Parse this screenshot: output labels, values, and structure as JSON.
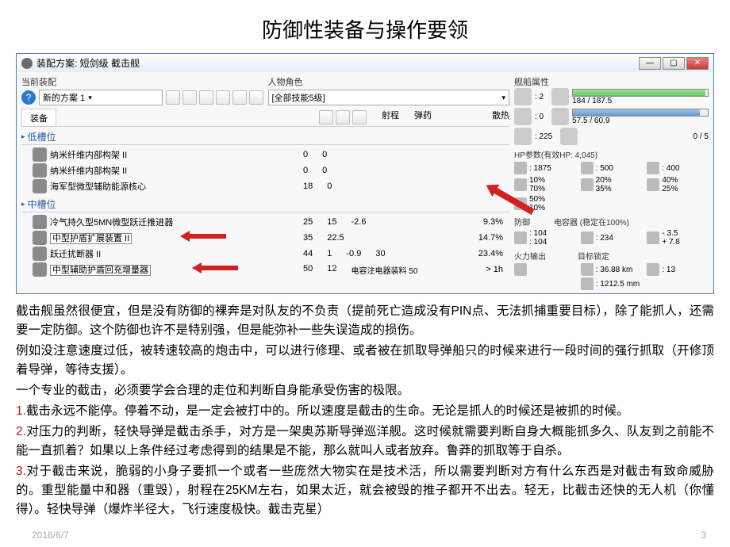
{
  "slide_title": "防御性装备与操作要领",
  "window": {
    "title": "装配方案: 短剑级 截击舰",
    "labels": {
      "current_fit": "当前装配",
      "char": "人物角色",
      "ship_attr": "舰船属性"
    },
    "scheme": "新的方案 1",
    "skill": "[全部技能5级]",
    "help": "?"
  },
  "tabs": {
    "equip": "装备"
  },
  "cols": {
    "c1": "射程",
    "c2": "弹药",
    "c3": "散热"
  },
  "sections": {
    "low": "低槽位",
    "mid": "中槽位"
  },
  "low_mods": [
    {
      "name": "纳米纤维内部构架 II",
      "v1": "0",
      "v2": "0"
    },
    {
      "name": "纳米纤维内部构架 II",
      "v1": "0",
      "v2": "0"
    },
    {
      "name": "海军型微型辅助能源核心",
      "v1": "18",
      "v2": "0"
    }
  ],
  "mid_mods": [
    {
      "name": "冷气持久型5MN微型跃迁推进器",
      "v1": "25",
      "v2": "15",
      "v3": "-2.6",
      "right": "9.3%"
    },
    {
      "name": "中型护盾扩展装置 II",
      "boxed": true,
      "v1": "35",
      "v2": "22.5",
      "right": "14.7%"
    },
    {
      "name": "跃迁扰断器 II",
      "v1": "44",
      "v2": "1",
      "v3": "-0.9",
      "v4": "30",
      "right": "23.4%"
    },
    {
      "name": "中型辅助护盾回充增量器",
      "boxed": true,
      "v1": "50",
      "v2": "12",
      "note": "电容注电器装料 50",
      "right": "> 1h"
    }
  ],
  "stats": {
    "hp_label": "184 / 187.5",
    "cap_label": "57.5 / 60.9",
    "slots": "0 / 5",
    "hp_header": "HP参数(有效HP: 4,045)",
    "shield": ": 1875",
    "armor": ": 500",
    "hull": ": 400",
    "res": [
      [
        "10%",
        "70%"
      ],
      [
        "20%",
        "35%"
      ],
      [
        "40%",
        "25%"
      ],
      [
        "50%",
        "10%"
      ]
    ],
    "defense_label": "防御",
    "def_v1": ": 104",
    "def_v2": ": 104",
    "cap_header": "电容器 (稳定在100%)",
    "cap_v": ": 234",
    "cap_delta1": "- 3.5",
    "cap_delta2": "+ 7.8",
    "dps_header": "火力输出",
    "lock_header": "目标锁定",
    "range": ": 36.88 km",
    "sig": ": 1212.5 mm",
    "targets": ": 13",
    "n2": ": 2",
    "n225": ": 225"
  },
  "body": {
    "p1": "截击舰虽然很便宜，但是没有防御的裸奔是对队友的不负责（提前死亡造成没有PIN点、无法抓捕重要目标），除了能抓人，还需要一定防御。这个防御也许不是特别强，但是能弥补一些失误造成的损伤。",
    "p2": "例如没注意速度过低，被转速较高的炮击中，可以进行修理、或者被在抓取导弹船只的时候来进行一段时间的强行抓取（开修顶着导弹，等待支援）。",
    "p3": " 一个专业的截击，必须要学会合理的走位和判断自身能承受伤害的极限。",
    "n1": "1.",
    "t1": "截击永远不能停。停着不动，是一定会被打中的。所以速度是截击的生命。无论是抓人的时候还是被抓的时候。",
    "n2": "2.",
    "t2": "对压力的判断，轻快导弹是截击杀手，对方是一架奥苏斯导弹巡洋舰。这时候就需要判断自身大概能抓多久、队友到之前能不能一直抓着？如果以上条件经过考虑得到的结果是不能，那么就叫人或者放弃。鲁莽的抓取等于自杀。",
    "n3": "3.",
    "t3": "对于截击来说，脆弱的小身子要抓一个或者一些庞然大物实在是技术活，所以需要判断对方有什么东西是对截击有致命威胁的。重型能量中和器（重毁），射程在25KM左右，如果太近，就会被毁的推子都开不出去。轻无，比截击还快的无人机（你懂得）。轻快导弹（爆炸半径大，飞行速度极快。截击克星）"
  },
  "page_num": "3",
  "date": "2016/6/7"
}
